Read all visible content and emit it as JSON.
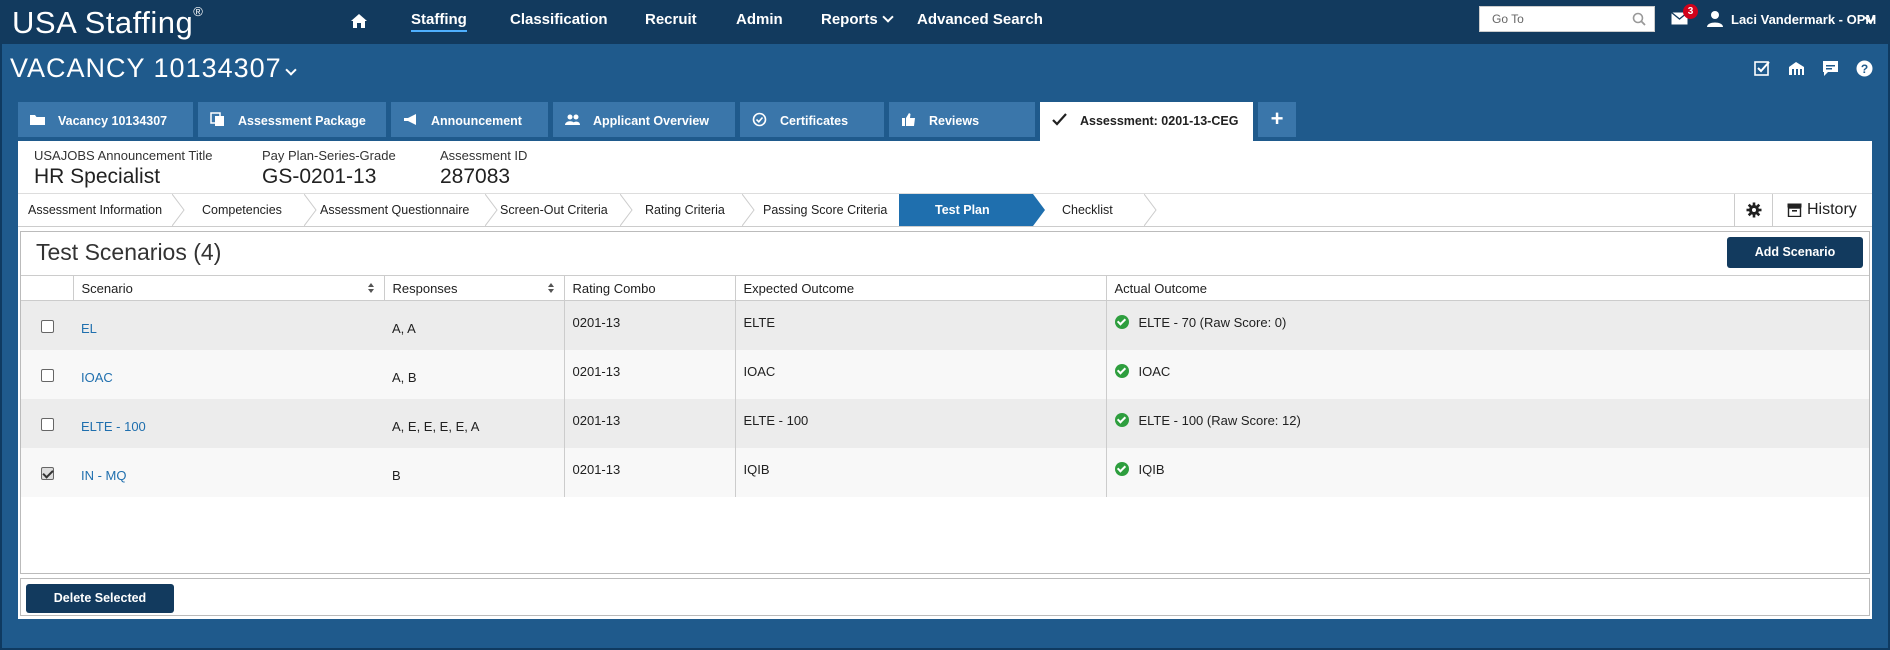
{
  "app": {
    "logo": "USA Staffing",
    "logo_mark": "®"
  },
  "nav": {
    "items": [
      "Staffing",
      "Classification",
      "Recruit",
      "Admin",
      "Reports",
      "Advanced Search"
    ],
    "goto_placeholder": "Go To",
    "mail_count": "3",
    "user": "Laci Vandermark - OPM"
  },
  "vacancy": {
    "title": "VACANCY 10134307"
  },
  "tabs": [
    {
      "label": "Vacancy 10134307",
      "icon": "folder-icon"
    },
    {
      "label": "Assessment Package",
      "icon": "copy-icon"
    },
    {
      "label": "Announcement",
      "icon": "megaphone-icon"
    },
    {
      "label": "Applicant Overview",
      "icon": "users-icon"
    },
    {
      "label": "Certificates",
      "icon": "certificate-icon"
    },
    {
      "label": "Reviews",
      "icon": "thumbs-up-icon"
    },
    {
      "label": "Assessment: 0201-13-CEG",
      "icon": "checkmark-icon"
    }
  ],
  "info": {
    "announcement_label": "USAJOBS Announcement Title",
    "announcement_value": "HR Specialist",
    "grade_label": "Pay Plan-Series-Grade",
    "grade_value": "GS-0201-13",
    "assessment_label": "Assessment ID",
    "assessment_value": "287083"
  },
  "steps": [
    "Assessment Information",
    "Competencies",
    "Assessment Questionnaire",
    "Screen-Out Criteria",
    "Rating Criteria",
    "Passing Score Criteria",
    "Test Plan",
    "Checklist"
  ],
  "history_label": "History",
  "scenarios": {
    "title": "Test Scenarios (4)",
    "add_label": "Add Scenario",
    "delete_label": "Delete Selected",
    "columns": [
      "Scenario",
      "Responses",
      "Rating Combo",
      "Expected Outcome",
      "Actual Outcome"
    ],
    "rows": [
      {
        "checked": false,
        "scenario": "EL",
        "responses": "A, A",
        "combo": "0201-13",
        "expected": "ELTE",
        "actual": "ELTE - 70 (Raw Score: 0)"
      },
      {
        "checked": false,
        "scenario": "IOAC",
        "responses": "A, B",
        "combo": "0201-13",
        "expected": "IOAC",
        "actual": "IOAC"
      },
      {
        "checked": false,
        "scenario": "ELTE - 100",
        "responses": "A, E, E, E, E, A",
        "combo": "0201-13",
        "expected": "ELTE - 100",
        "actual": "ELTE - 100 (Raw Score: 12)"
      },
      {
        "checked": true,
        "scenario": "IN - MQ",
        "responses": "B",
        "combo": "0201-13",
        "expected": "IQIB",
        "actual": "IQIB"
      }
    ]
  }
}
